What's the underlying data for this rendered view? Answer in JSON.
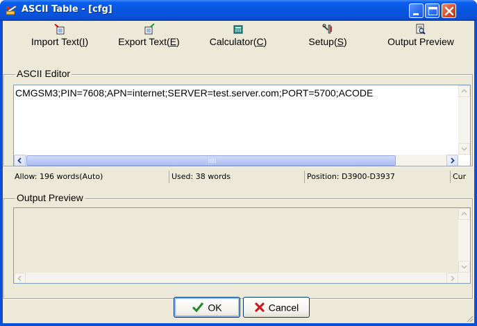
{
  "window": {
    "title": "ASCII Table - [cfg]"
  },
  "toolbar": {
    "items": [
      {
        "label": "Import Text(",
        "key": "I",
        "tail": ")",
        "icon": "import-text-icon"
      },
      {
        "label": "Export Text(",
        "key": "E",
        "tail": ")",
        "icon": "export-text-icon"
      },
      {
        "label": "Calculator(",
        "key": "C",
        "tail": ")",
        "icon": "calculator-icon"
      },
      {
        "label": "Setup(",
        "key": "S",
        "tail": ")",
        "icon": "setup-tools-icon"
      },
      {
        "label": "Output Preview",
        "key": "",
        "tail": "",
        "icon": "output-preview-icon"
      }
    ]
  },
  "editor": {
    "group_label": "ASCII Editor",
    "text": "CMGSM3;PIN=7608;APN=internet;SERVER=test.server.com;PORT=5700;ACODE"
  },
  "status": {
    "allow": "Allow: 196 words(Auto)",
    "used": "Used: 38 words",
    "position": "Position: D3900-D3937",
    "cur": "Cur"
  },
  "preview": {
    "group_label": "Output Preview"
  },
  "buttons": {
    "ok": "OK",
    "cancel": "Cancel"
  },
  "colors": {
    "titlebar": "#0a4fd6",
    "face": "#ece9d8"
  }
}
